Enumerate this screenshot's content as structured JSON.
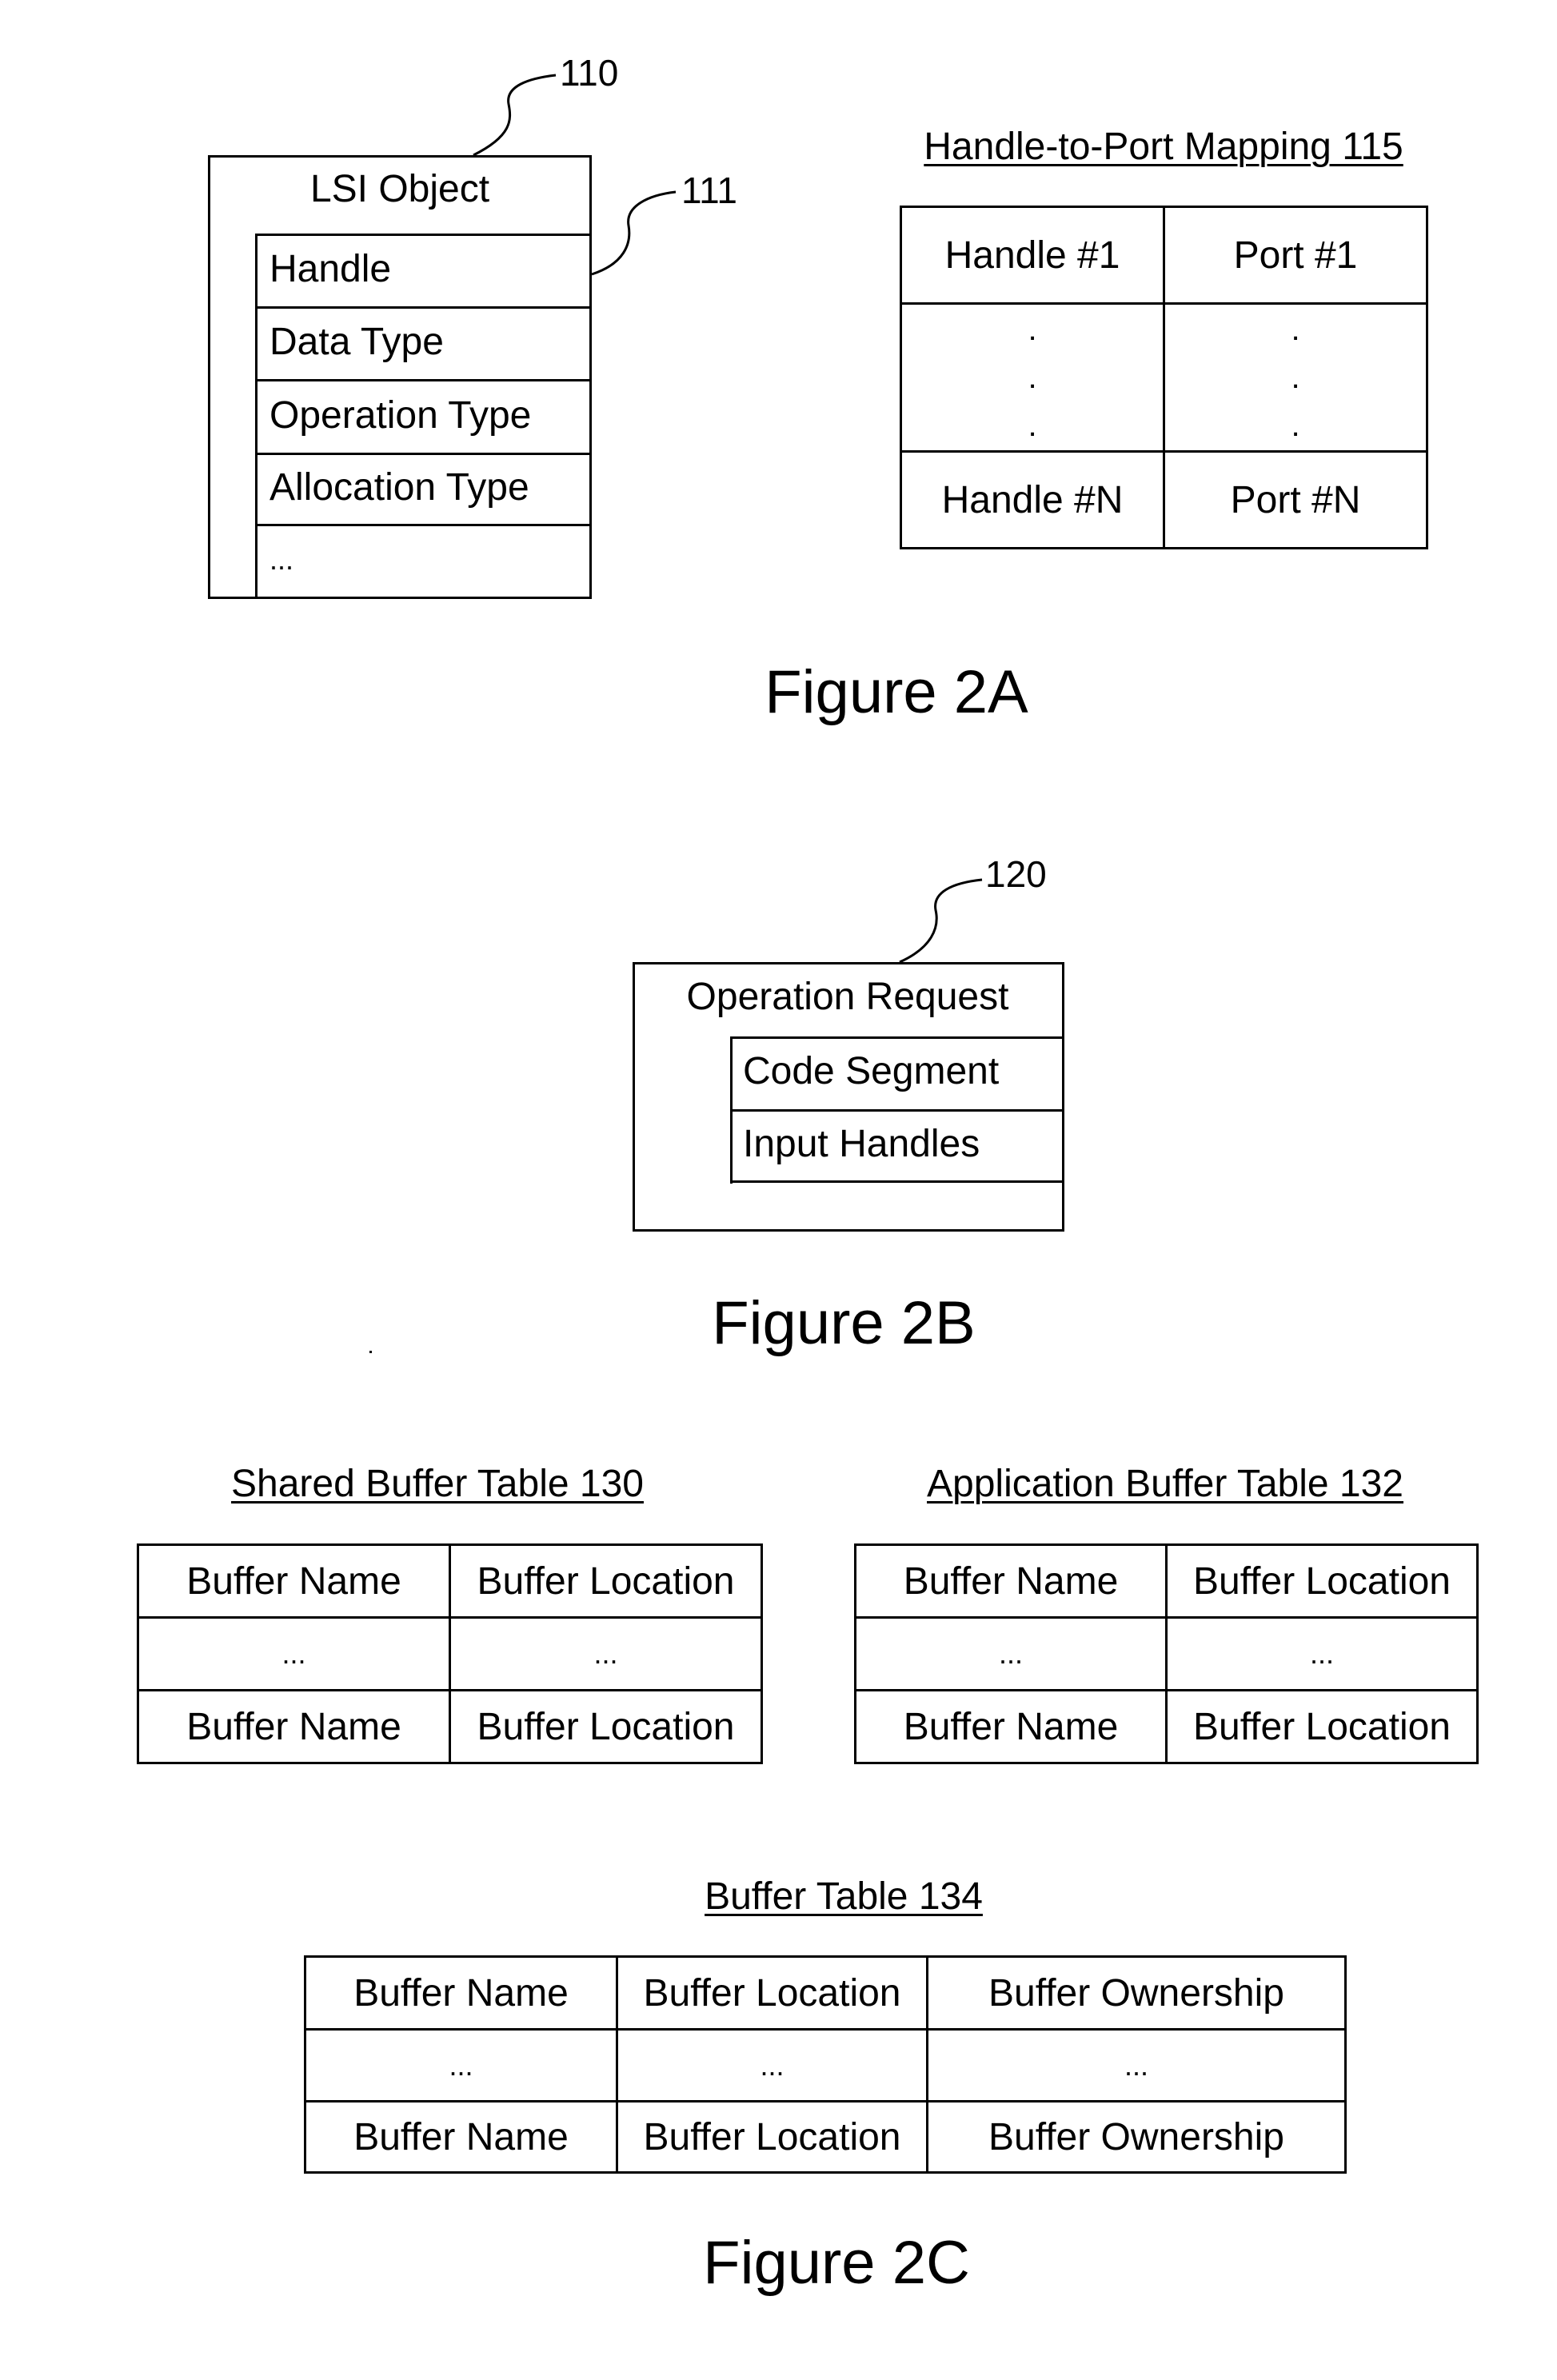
{
  "figure_2a": {
    "caption": "Figure 2A",
    "lsi_object": {
      "ref": "110",
      "title": "LSI Object",
      "fields_ref": "111",
      "fields": [
        "Handle",
        "Data Type",
        "Operation Type",
        "Allocation Type",
        "..."
      ]
    },
    "handle_to_port": {
      "title": "Handle-to-Port Mapping 115",
      "rows": [
        [
          "Handle #1",
          "Port #1"
        ],
        [
          ".\n.\n.",
          ".\n.\n."
        ],
        [
          "Handle #N",
          "Port #N"
        ]
      ]
    }
  },
  "figure_2b": {
    "caption": "Figure 2B",
    "operation_request": {
      "ref": "120",
      "title": "Operation Request",
      "fields": [
        "Code Segment",
        "Input Handles"
      ]
    }
  },
  "figure_2c": {
    "caption": "Figure 2C",
    "shared_buffer_table": {
      "title": "Shared Buffer Table 130",
      "rows": [
        [
          "Buffer Name",
          "Buffer Location"
        ],
        [
          "...",
          "..."
        ],
        [
          "Buffer Name",
          "Buffer Location"
        ]
      ]
    },
    "application_buffer_table": {
      "title": "Application Buffer Table 132",
      "rows": [
        [
          "Buffer Name",
          "Buffer Location"
        ],
        [
          "...",
          "..."
        ],
        [
          "Buffer Name",
          "Buffer Location"
        ]
      ]
    },
    "buffer_table": {
      "title": "Buffer Table 134",
      "rows": [
        [
          "Buffer Name",
          "Buffer Location",
          "Buffer Ownership"
        ],
        [
          "...",
          "...",
          "..."
        ],
        [
          "Buffer Name",
          "Buffer Location",
          "Buffer Ownership"
        ]
      ]
    }
  }
}
